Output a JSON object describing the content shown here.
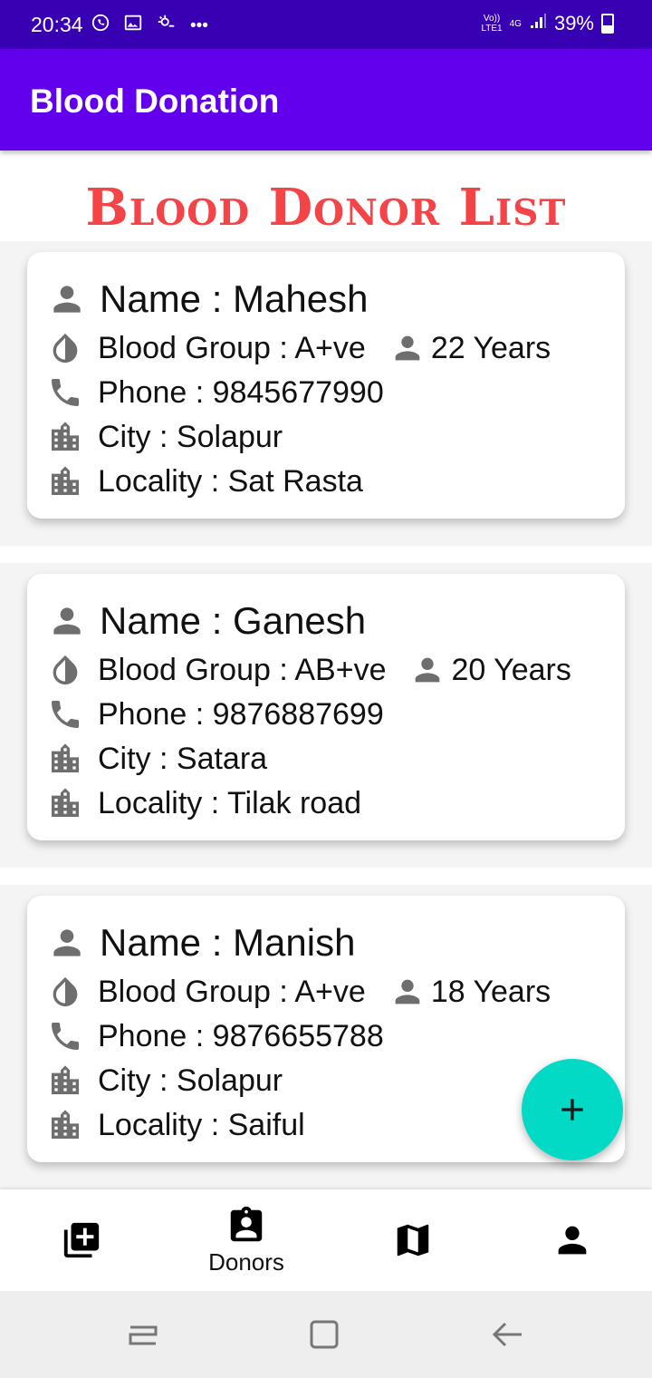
{
  "status_bar": {
    "time": "20:34",
    "more_dots": "•••",
    "volte_label_top": "Vo))",
    "volte_label_bottom": "LTE1",
    "network_label": "4G",
    "battery_percent": "39%",
    "battery_level": 0.39
  },
  "app_bar": {
    "title": "Blood Donation"
  },
  "page": {
    "title": "Blood Donor List"
  },
  "donors": [
    {
      "name": "Name : Mahesh",
      "blood_group": "Blood Group : A+ve",
      "age": "22 Years",
      "phone": "Phone : 9845677990",
      "city": "City : Solapur",
      "locality": "Locality : Sat Rasta"
    },
    {
      "name": "Name : Ganesh",
      "blood_group": "Blood Group : AB+ve",
      "age": "20 Years",
      "phone": "Phone : 9876887699",
      "city": "City : Satara",
      "locality": "Locality : Tilak road"
    },
    {
      "name": "Name : Manish",
      "blood_group": "Blood Group : A+ve",
      "age": "18 Years",
      "phone": "Phone : 9876655788",
      "city": "City : Solapur",
      "locality": "Locality : Saiful"
    }
  ],
  "bottom_nav": {
    "items": [
      {
        "icon": "add-box-icon",
        "label": ""
      },
      {
        "icon": "assignment-ind-icon",
        "label": "Donors"
      },
      {
        "icon": "map-icon",
        "label": ""
      },
      {
        "icon": "person-icon",
        "label": ""
      }
    ],
    "selected": "Donors"
  },
  "fab": {
    "icon": "plus-icon",
    "color": "#03dac5"
  },
  "colors": {
    "status_bar": "#3700b3",
    "app_bar": "#6200ee",
    "title_red": "#f44448",
    "icon_gray": "#6e6e6e"
  }
}
